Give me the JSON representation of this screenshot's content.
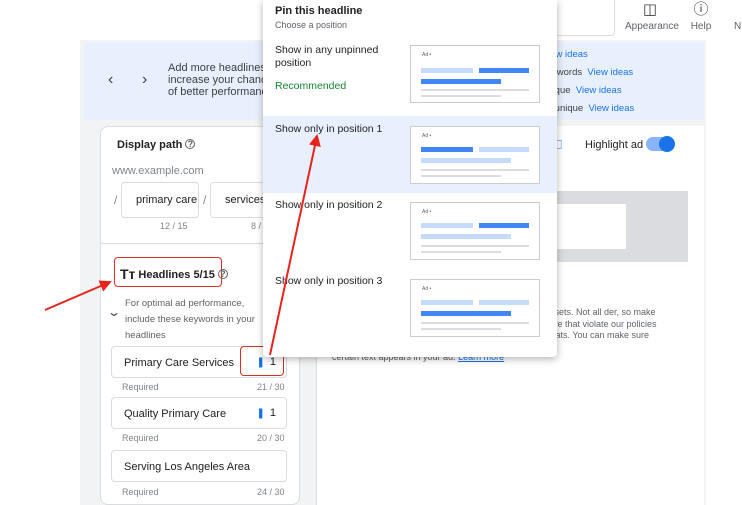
{
  "topbar": {
    "appearance_label": "Appearance",
    "help_label": "Help",
    "overflow_char": "N"
  },
  "banner": {
    "text": "Add more headlines to increase your chances of better performance",
    "tips": [
      {
        "text": "",
        "link": "View ideas"
      },
      {
        "text": "keywords",
        "link": "View ideas"
      },
      {
        "text": "unique",
        "link": "View ideas"
      },
      {
        "text": "ns unique",
        "link": "View ideas"
      }
    ]
  },
  "display_path": {
    "title": "Display path",
    "url": "www.example.com",
    "path1": "primary care",
    "path1_count": "12 / 15",
    "path2": "services",
    "path2_count": "8 /"
  },
  "headlines": {
    "title": "Headlines 5/15",
    "optimal_text": "For optimal ad performance, include these keywords in your headlines",
    "items": [
      {
        "text": "Primary Care Services",
        "pin": "1",
        "req": "Required",
        "count": "21 / 30"
      },
      {
        "text": "Quality Primary Care",
        "pin": "1",
        "req": "Required",
        "count": "20 / 30"
      },
      {
        "text": "Serving Los Angeles Area",
        "pin": "",
        "req": "Required",
        "count": "24 / 30"
      }
    ]
  },
  "preview": {
    "highlight_label": "Highlight ad",
    "note": "assets. Not all der, so make sure that violate our policies or ats. You can make sure",
    "note_bottom": "certain text appears in your ad.",
    "learn_more": "Learn more"
  },
  "popup": {
    "title": "Pin this headline",
    "subtitle": "Choose a position",
    "options": [
      {
        "label": "Show in any unpinned position",
        "recommended": "Recommended"
      },
      {
        "label": "Show only in position 1"
      },
      {
        "label": "Show only in position 2"
      },
      {
        "label": "Show only in position 3"
      }
    ],
    "thumb_ad_label": "Ad •"
  },
  "colors": {
    "accent": "#1a73e8",
    "annotation": "#d93025",
    "selected_bg": "#e8f0fe",
    "recommended": "#188038"
  }
}
